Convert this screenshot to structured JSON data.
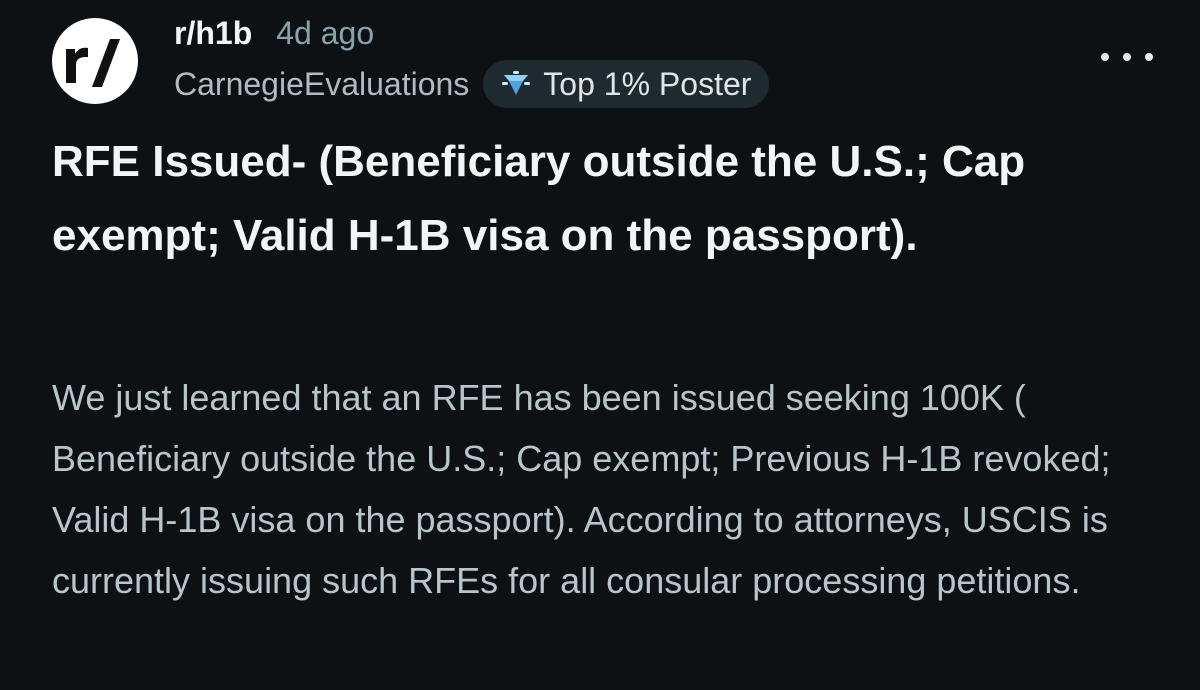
{
  "post": {
    "subreddit": "r/h1b",
    "time_ago": "4d ago",
    "author": "CarnegieEvaluations",
    "flair": {
      "icon": "diamond-badge-icon",
      "label": "Top 1% Poster"
    },
    "avatar_icon": "reddit-r-slash-logo-icon",
    "more_icon": "more-options-icon",
    "title": "RFE Issued- (Beneficiary outside the U.S.; Cap exempt; Valid H-1B visa on the passport).",
    "body": "We just learned that an RFE has been issued seeking 100K ( Beneficiary outside the U.S.; Cap exempt; Previous H-1B revoked; Valid H-1B visa on the passport). According to attorneys, USCIS is currently issuing such RFEs for all consular processing petitions."
  },
  "colors": {
    "background": "#0e1113",
    "title_text": "#f2f4f5",
    "body_text": "#b8c5cb",
    "meta_text": "#8ba2ad",
    "flair_bg": "#1f2a2f"
  }
}
